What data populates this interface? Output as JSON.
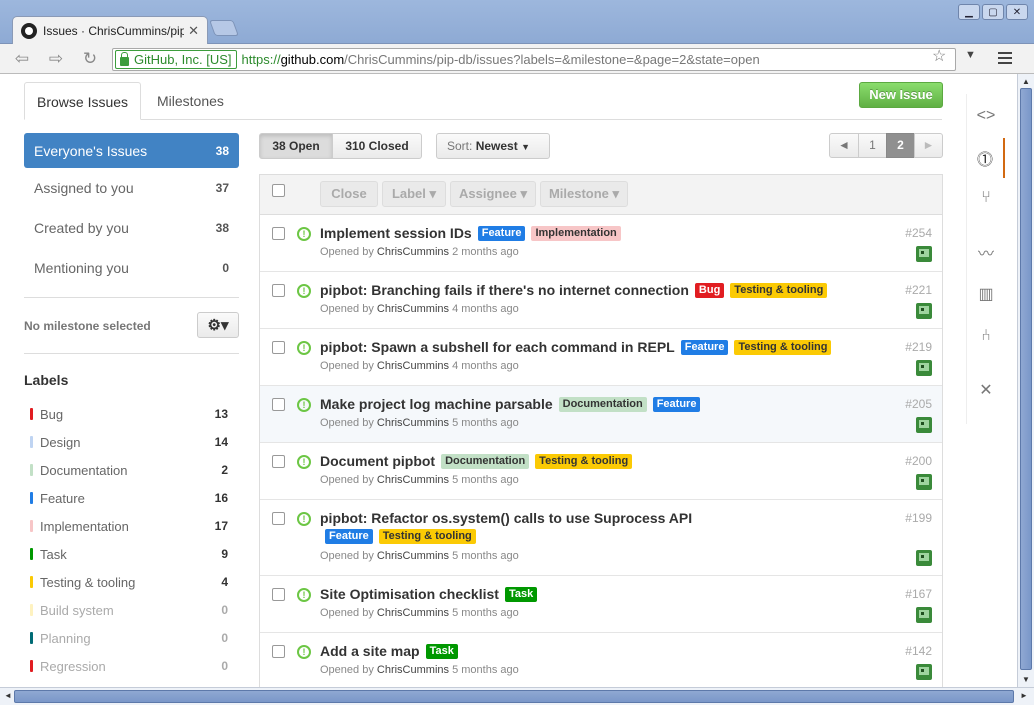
{
  "browser": {
    "tab_title": "Issues · ChrisCummins/pip-",
    "ev_label": "GitHub, Inc. [US]",
    "url_proto": "https://",
    "url_host": "github.com",
    "url_path": "/ChrisCummins/pip-db/issues?labels=&milestone=&page=2&state=open"
  },
  "nav": {
    "tabs": [
      "Browse Issues",
      "Milestones"
    ],
    "new_issue": "New Issue"
  },
  "filters": [
    {
      "label": "Everyone's Issues",
      "count": "38"
    },
    {
      "label": "Assigned to you",
      "count": "37"
    },
    {
      "label": "Created by you",
      "count": "38"
    },
    {
      "label": "Mentioning you",
      "count": "0"
    }
  ],
  "milestone_text": "No milestone selected",
  "labels_heading": "Labels",
  "labels": [
    {
      "name": "Bug",
      "count": "13",
      "color": "#e11d21"
    },
    {
      "name": "Design",
      "count": "14",
      "color": "#bfd4f2"
    },
    {
      "name": "Documentation",
      "count": "2",
      "color": "#c2e0c6"
    },
    {
      "name": "Feature",
      "count": "16",
      "color": "#207de5"
    },
    {
      "name": "Implementation",
      "count": "17",
      "color": "#f7c6c7"
    },
    {
      "name": "Task",
      "count": "9",
      "color": "#009800"
    },
    {
      "name": "Testing & tooling",
      "count": "4",
      "color": "#fbca04"
    },
    {
      "name": "Build system",
      "count": "0",
      "color": "#fef2c0"
    },
    {
      "name": "Planning",
      "count": "0",
      "color": "#006b75"
    },
    {
      "name": "Regression",
      "count": "0",
      "color": "#e11d21"
    }
  ],
  "state": {
    "open": "38 Open",
    "closed": "310 Closed"
  },
  "sort": {
    "prefix": "Sort:",
    "value": "Newest"
  },
  "pagination": {
    "prev": "◄",
    "p1": "1",
    "p2": "2",
    "next": "►"
  },
  "actions": {
    "close": "Close",
    "label": "Label",
    "assignee": "Assignee",
    "milestone": "Milestone"
  },
  "issue_author": "ChrisCummins",
  "opened_by": "Opened by",
  "issues": [
    {
      "title": "Implement session IDs",
      "number": "#254",
      "age": "2 months ago",
      "tags": [
        "Feature",
        "Implementation"
      ]
    },
    {
      "title": "pipbot: Branching fails if there's no internet connection",
      "number": "#221",
      "age": "4 months ago",
      "tags": [
        "Bug",
        "Testing & tooling"
      ]
    },
    {
      "title": "pipbot: Spawn a subshell for each command in REPL",
      "number": "#219",
      "age": "4 months ago",
      "tags": [
        "Feature",
        "Testing & tooling"
      ]
    },
    {
      "title": "Make project log machine parsable",
      "number": "#205",
      "age": "5 months ago",
      "tags": [
        "Documentation",
        "Feature"
      ]
    },
    {
      "title": "Document pipbot",
      "number": "#200",
      "age": "5 months ago",
      "tags": [
        "Documentation",
        "Testing & tooling"
      ]
    },
    {
      "title": "pipbot: Refactor os.system() calls to use Suprocess API",
      "number": "#199",
      "age": "5 months ago",
      "tags": [
        "Feature",
        "Testing & tooling"
      ]
    },
    {
      "title": "Site Optimisation checklist",
      "number": "#167",
      "age": "5 months ago",
      "tags": [
        "Task"
      ]
    },
    {
      "title": "Add a site map",
      "number": "#142",
      "age": "5 months ago",
      "tags": [
        "Task"
      ]
    }
  ],
  "tag_styles": {
    "Feature": {
      "bg": "#207de5",
      "fg": "#ffffff"
    },
    "Implementation": {
      "bg": "#f7c6c7",
      "fg": "#333333"
    },
    "Bug": {
      "bg": "#e11d21",
      "fg": "#ffffff"
    },
    "Testing & tooling": {
      "bg": "#fbca04",
      "fg": "#333333"
    },
    "Documentation": {
      "bg": "#c2e0c6",
      "fg": "#333333"
    },
    "Task": {
      "bg": "#009800",
      "fg": "#ffffff"
    }
  }
}
